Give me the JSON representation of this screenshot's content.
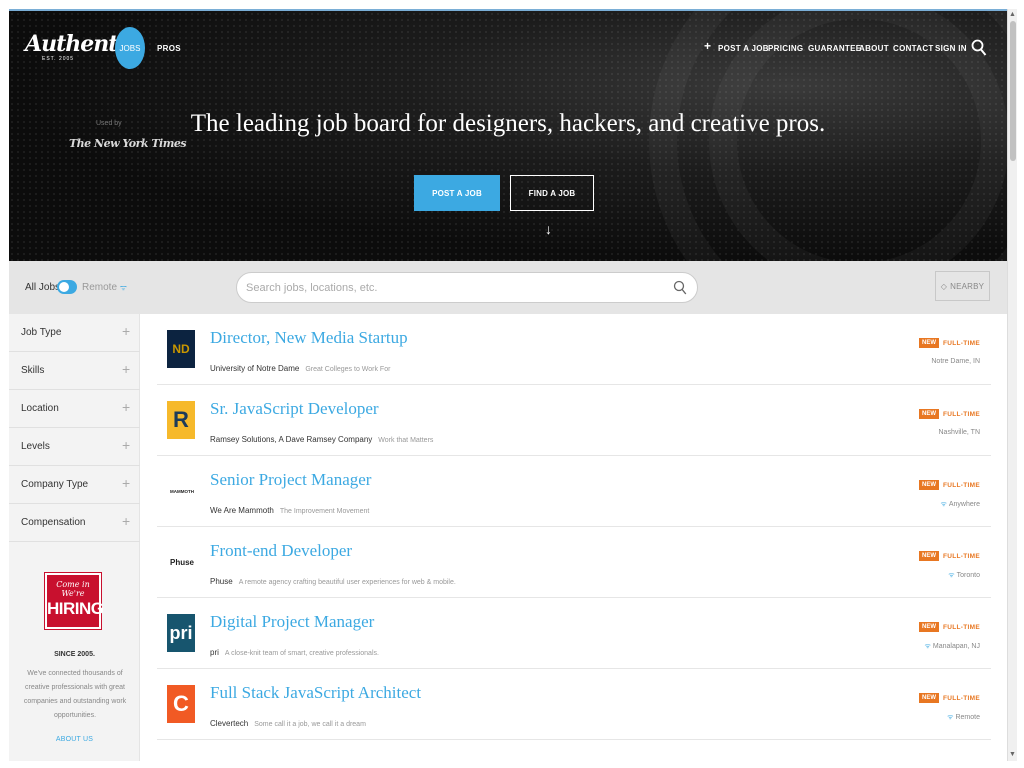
{
  "header": {
    "logo_text": "Authentic",
    "logo_sub": "EST. 2005",
    "jobs_label": "JOBS",
    "pros_label": "PROS",
    "nav": [
      "POST A JOB",
      "PRICING",
      "GUARANTEE",
      "ABOUT",
      "CONTACT",
      "SIGN IN"
    ]
  },
  "hero": {
    "used_by": "Used by",
    "used_by_logo": "The New York Times",
    "headline": "The leading job board for designers, hackers, and creative pros.",
    "post_button": "POST A JOB",
    "find_button": "FIND A JOB"
  },
  "filter": {
    "all_jobs": "All Jobs",
    "remote": "Remote",
    "search_placeholder": "Search jobs, locations, etc.",
    "nearby": "NEARBY"
  },
  "facets": [
    "Job Type",
    "Skills",
    "Location",
    "Levels",
    "Company Type",
    "Compensation"
  ],
  "promo": {
    "badge_line1": "Come in We're",
    "badge_line2": "HIRING",
    "since": "SINCE 2005.",
    "text": "We've connected thousands of creative professionals with great companies and outstanding work opportunities.",
    "link": "ABOUT US"
  },
  "jobs": [
    {
      "title": "Director, New Media Startup",
      "company": "University of Notre Dame",
      "tagline": "Great Colleges to Work For",
      "badge": "NEW",
      "type": "FULL-TIME",
      "location": "Notre Dame, IN",
      "remote": false,
      "logo_text": "ND",
      "logo_bg": "#0c2340",
      "logo_fg": "#c99700"
    },
    {
      "title": "Sr. JavaScript Developer",
      "company": "Ramsey Solutions, A Dave Ramsey Company",
      "tagline": "Work that Matters",
      "badge": "NEW",
      "type": "FULL-TIME",
      "location": "Nashville, TN",
      "remote": false,
      "logo_text": "R",
      "logo_bg": "#f6b92b",
      "logo_fg": "#1d3b5a"
    },
    {
      "title": "Senior Project Manager",
      "company": "We Are Mammoth",
      "tagline": "The Improvement Movement",
      "badge": "NEW",
      "type": "FULL-TIME",
      "location": "Anywhere",
      "remote": true,
      "logo_text": "MAMMOTH",
      "logo_bg": "#ffffff",
      "logo_fg": "#222222"
    },
    {
      "title": "Front-end Developer",
      "company": "Phuse",
      "tagline": "A remote agency crafting beautiful user experiences for web & mobile.",
      "badge": "NEW",
      "type": "FULL-TIME",
      "location": "Toronto",
      "remote": true,
      "logo_text": "Phuse",
      "logo_bg": "#ffffff",
      "logo_fg": "#222222"
    },
    {
      "title": "Digital Project Manager",
      "company": "pri",
      "tagline": "A close-knit team of smart, creative professionals.",
      "badge": "NEW",
      "type": "FULL-TIME",
      "location": "Manalapan, NJ",
      "remote": true,
      "logo_text": "pri",
      "logo_bg": "#17556e",
      "logo_fg": "#ffffff"
    },
    {
      "title": "Full Stack JavaScript Architect",
      "company": "Clevertech",
      "tagline": "Some call it a job, we call it a dream",
      "badge": "NEW",
      "type": "FULL-TIME",
      "location": "Remote",
      "remote": true,
      "logo_text": "C",
      "logo_bg": "#f15a24",
      "logo_fg": "#ffffff"
    }
  ],
  "colors": {
    "accent": "#3ca9e2",
    "new_badge": "#e87722",
    "hiring_red": "#c8102e"
  }
}
